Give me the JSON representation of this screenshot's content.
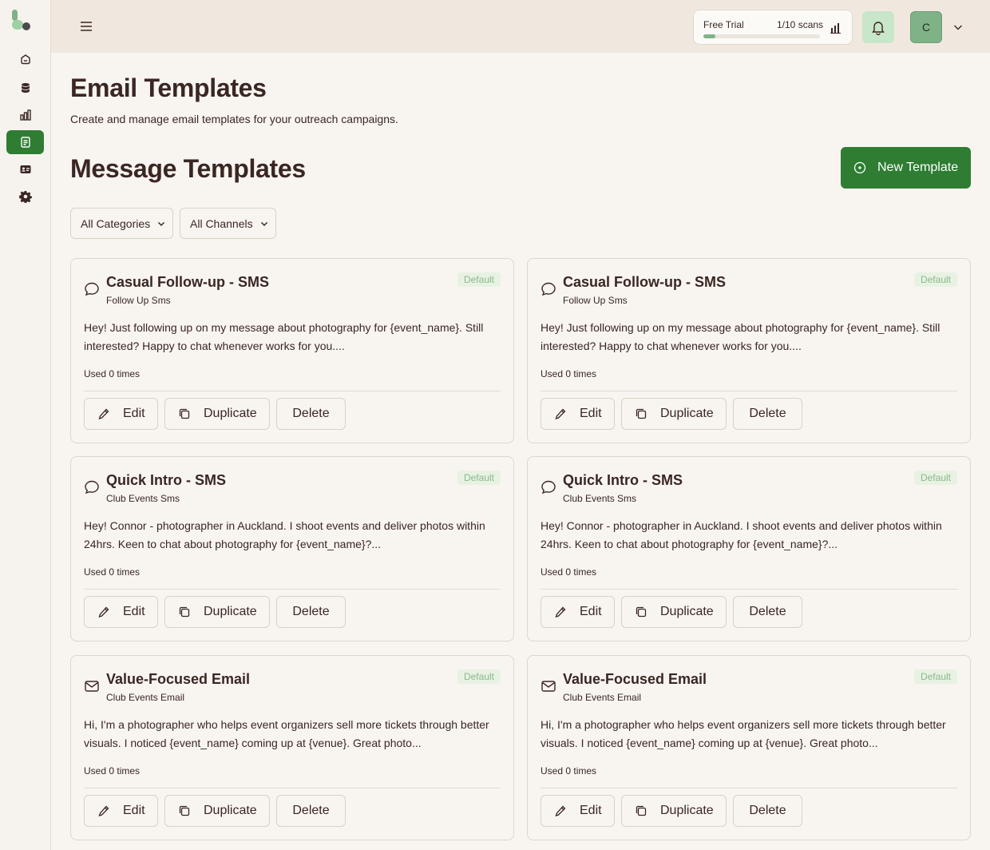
{
  "topbar": {
    "trial_label": "Free Trial",
    "scans": "1/10 scans",
    "progress": 0.1,
    "avatar_letter": "C"
  },
  "header": {
    "title": "Email Templates",
    "subtitle": "Create and manage email templates for your outreach campaigns."
  },
  "section": {
    "title": "Message Templates",
    "new_button": "New Template"
  },
  "filters": {
    "category": "All Categories",
    "channel": "All Channels"
  },
  "actions": {
    "edit": "Edit",
    "duplicate": "Duplicate",
    "delete": "Delete"
  },
  "templates": [
    {
      "title": "Casual Follow-up - SMS",
      "category": "Follow Up Sms",
      "badge": "Default",
      "icon": "chat-bubble-icon",
      "body": "Hey! Just following up on my message about photography for {event_name}. Still interested? Happy to chat whenever works for you....",
      "used": "Used 0 times"
    },
    {
      "title": "Casual Follow-up - SMS",
      "category": "Follow Up Sms",
      "badge": "Default",
      "icon": "chat-bubble-icon",
      "body": "Hey! Just following up on my message about photography for {event_name}. Still interested? Happy to chat whenever works for you....",
      "used": "Used 0 times"
    },
    {
      "title": "Quick Intro - SMS",
      "category": "Club Events Sms",
      "badge": "Default",
      "icon": "chat-bubble-icon",
      "body": "Hey! Connor - photographer in Auckland. I shoot events and deliver photos within 24hrs. Keen to chat about photography for {event_name}?...",
      "used": "Used 0 times"
    },
    {
      "title": "Quick Intro - SMS",
      "category": "Club Events Sms",
      "badge": "Default",
      "icon": "chat-bubble-icon",
      "body": "Hey! Connor - photographer in Auckland. I shoot events and deliver photos within 24hrs. Keen to chat about photography for {event_name}?...",
      "used": "Used 0 times"
    },
    {
      "title": "Value-Focused Email",
      "category": "Club Events Email",
      "badge": "Default",
      "icon": "envelope-icon",
      "body": "Hi, I'm a photographer who helps event organizers sell more tickets through better visuals. I noticed {event_name} coming up at {venue}. Great photo...",
      "used": "Used 0 times"
    },
    {
      "title": "Value-Focused Email",
      "category": "Club Events Email",
      "badge": "Default",
      "icon": "envelope-icon",
      "body": "Hi, I'm a photographer who helps event organizers sell more tickets through better visuals. I noticed {event_name} coming up at {venue}. Great photo...",
      "used": "Used 0 times"
    }
  ]
}
